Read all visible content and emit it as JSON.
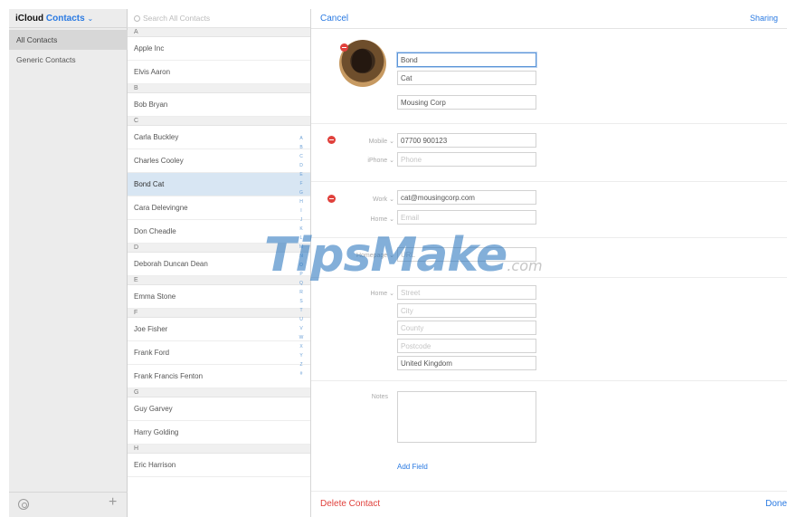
{
  "sidebar": {
    "app_name": "iCloud",
    "section": "Contacts",
    "groups": [
      "All Contacts",
      "Generic Contacts"
    ],
    "footer_add": "+"
  },
  "list": {
    "search_placeholder": "Search All Contacts",
    "index_letters": [
      "A",
      "B",
      "C",
      "D",
      "E",
      "F",
      "G",
      "H",
      "I",
      "J",
      "K",
      "L",
      "M",
      "N",
      "O",
      "P",
      "Q",
      "R",
      "S",
      "T",
      "U",
      "V",
      "W",
      "X",
      "Y",
      "Z",
      "#"
    ],
    "sections": [
      {
        "letter": "A",
        "contacts": [
          "Apple Inc",
          "Elvis Aaron"
        ]
      },
      {
        "letter": "B",
        "contacts": [
          "Bob Bryan"
        ]
      },
      {
        "letter": "C",
        "contacts": [
          "Carla Buckley",
          "Charles Cooley",
          "Bond Cat",
          "Cara Delevingne",
          "Don Cheadle"
        ]
      },
      {
        "letter": "D",
        "contacts": [
          "Deborah Duncan Dean"
        ]
      },
      {
        "letter": "E",
        "contacts": [
          "Emma Stone"
        ]
      },
      {
        "letter": "F",
        "contacts": [
          "Joe Fisher",
          "Frank Ford",
          "Frank Francis Fenton"
        ]
      },
      {
        "letter": "G",
        "contacts": [
          "Guy Garvey",
          "Harry Golding"
        ]
      },
      {
        "letter": "H",
        "contacts": [
          "Eric Harrison"
        ]
      }
    ],
    "selected_contact": "Bond Cat"
  },
  "detail": {
    "cancel_label": "Cancel",
    "topright_label": "Sharing",
    "first_name": "Bond",
    "last_name": "Cat",
    "company": "Mousing Corp",
    "phone_rows": [
      {
        "label": "Mobile",
        "value": "07700 900123",
        "placeholder": ""
      },
      {
        "label": "iPhone",
        "value": "",
        "placeholder": "Phone"
      }
    ],
    "email_rows": [
      {
        "label": "Work",
        "value": "cat@mousingcorp.com",
        "placeholder": ""
      },
      {
        "label": "Home",
        "value": "",
        "placeholder": "Email"
      }
    ],
    "homepage_label": "Homepage",
    "homepage_placeholder": "URL",
    "address": {
      "label": "Home",
      "street_placeholder": "Street",
      "city_placeholder": "City",
      "county_placeholder": "County",
      "postcode_placeholder": "Postcode",
      "country": "United Kingdom"
    },
    "notes_label": "Notes",
    "add_field_label": "Add Field",
    "delete_label": "Delete Contact",
    "done_label": "Done"
  },
  "watermark": {
    "main": "TipsMake",
    "suffix": ".com"
  },
  "colors": {
    "accent": "#2a7ae2",
    "destructive": "#e0413c",
    "selection": "#d8e6f3"
  }
}
